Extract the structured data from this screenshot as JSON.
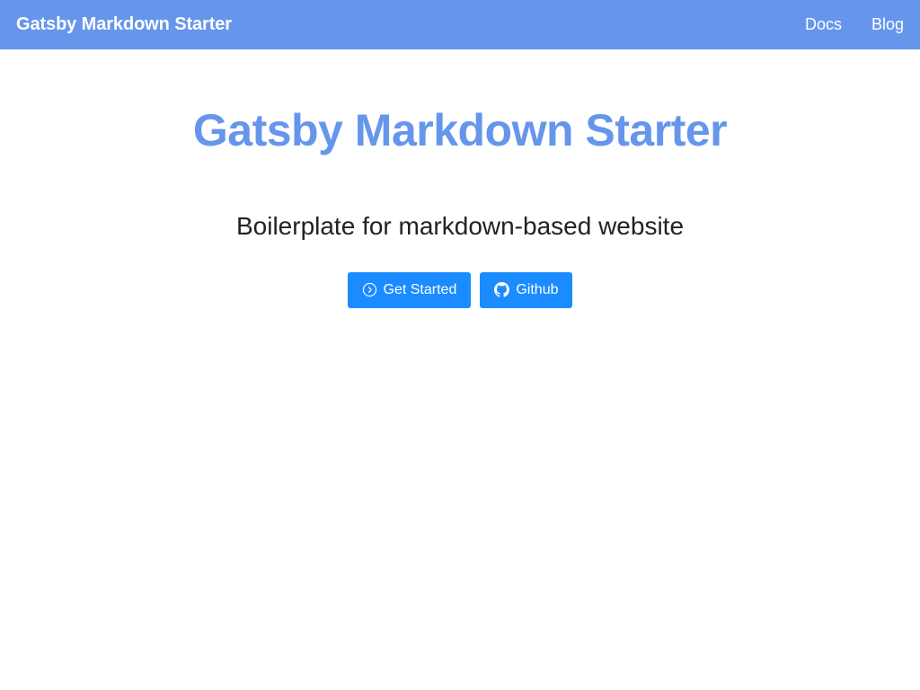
{
  "header": {
    "brand": "Gatsby Markdown Starter",
    "nav": [
      {
        "label": "Docs"
      },
      {
        "label": "Blog"
      }
    ],
    "background_color": "#6596ec"
  },
  "hero": {
    "title": "Gatsby Markdown Starter",
    "title_color": "#6596ec",
    "subtitle": "Boilerplate for markdown-based website",
    "buttons": [
      {
        "label": "Get Started",
        "icon": "play-circle-icon",
        "color": "#1a8cff"
      },
      {
        "label": "Github",
        "icon": "github-icon",
        "color": "#1a8cff"
      }
    ]
  }
}
